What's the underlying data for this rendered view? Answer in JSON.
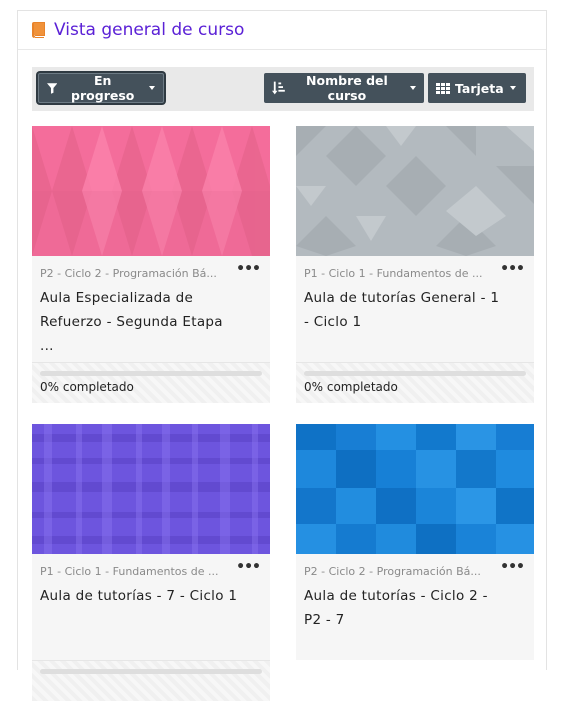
{
  "header": {
    "title": "Vista general de curso",
    "icon": "book-icon",
    "accent": "#5b21d6"
  },
  "toolbar": {
    "filter_label": "En progreso",
    "sort_label": "Nombre del curso",
    "view_label": "Tarjeta",
    "button_color": "#44515b"
  },
  "courses": [
    {
      "category": "P2 - Ciclo 2 - Programación Bá...",
      "name": "Aula Especializada de Refuerzo - Segunda Etapa ...",
      "progress_label": "0% completado",
      "progress": 0
    },
    {
      "category": "P1 - Ciclo 1 - Fundamentos de ...",
      "name": "Aula de tutorías General - 1 - Ciclo 1",
      "progress_label": "0% completado",
      "progress": 0
    },
    {
      "category": "P1 - Ciclo 1 - Fundamentos de ...",
      "name": "Aula de tutorías - 7 - Ciclo 1",
      "progress_label": "",
      "progress": 0
    },
    {
      "category": "P2 - Ciclo 2 - Programación Bá...",
      "name": "Aula de tutorías - Ciclo 2 - P2 - 7",
      "progress_label": "",
      "progress": 0
    }
  ],
  "card_menu_glyph": "•••"
}
